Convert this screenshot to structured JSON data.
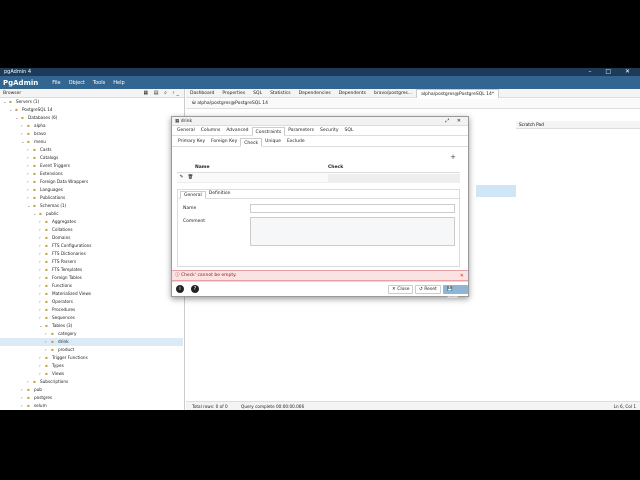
{
  "window": {
    "title": "pgAdmin 4",
    "controls": [
      "–",
      "□",
      "✕"
    ]
  },
  "menu": {
    "logo": "PgAdmin",
    "items": [
      "File",
      "Object",
      "Tools",
      "Help"
    ]
  },
  "browser": {
    "title": "Browser",
    "tree": [
      {
        "label": "Servers (1)",
        "indent": 0,
        "open": true
      },
      {
        "label": "PostgreSQL 14",
        "indent": 1,
        "open": true
      },
      {
        "label": "Databases (6)",
        "indent": 2,
        "open": true
      },
      {
        "label": "alpha",
        "indent": 3,
        "open": false
      },
      {
        "label": "bravo",
        "indent": 3,
        "open": false
      },
      {
        "label": "menu",
        "indent": 3,
        "open": true
      },
      {
        "label": "Casts",
        "indent": 4,
        "open": false
      },
      {
        "label": "Catalogs",
        "indent": 4,
        "open": false
      },
      {
        "label": "Event Triggers",
        "indent": 4,
        "open": false
      },
      {
        "label": "Extensions",
        "indent": 4,
        "open": false
      },
      {
        "label": "Foreign Data Wrappers",
        "indent": 4,
        "open": false
      },
      {
        "label": "Languages",
        "indent": 4,
        "open": false
      },
      {
        "label": "Publications",
        "indent": 4,
        "open": false
      },
      {
        "label": "Schemas (1)",
        "indent": 4,
        "open": true
      },
      {
        "label": "public",
        "indent": 5,
        "open": true
      },
      {
        "label": "Aggregates",
        "indent": 6,
        "open": false
      },
      {
        "label": "Collations",
        "indent": 6,
        "open": false
      },
      {
        "label": "Domains",
        "indent": 6,
        "open": false
      },
      {
        "label": "FTS Configurations",
        "indent": 6,
        "open": false
      },
      {
        "label": "FTS Dictionaries",
        "indent": 6,
        "open": false
      },
      {
        "label": "FTS Parsers",
        "indent": 6,
        "open": false
      },
      {
        "label": "FTS Templates",
        "indent": 6,
        "open": false
      },
      {
        "label": "Foreign Tables",
        "indent": 6,
        "open": false
      },
      {
        "label": "Functions",
        "indent": 6,
        "open": false
      },
      {
        "label": "Materialized Views",
        "indent": 6,
        "open": false
      },
      {
        "label": "Operators",
        "indent": 6,
        "open": false
      },
      {
        "label": "Procedures",
        "indent": 6,
        "open": false
      },
      {
        "label": "Sequences",
        "indent": 6,
        "open": false
      },
      {
        "label": "Tables (3)",
        "indent": 6,
        "open": true
      },
      {
        "label": "category",
        "indent": 7,
        "open": false
      },
      {
        "label": "drink",
        "indent": 7,
        "open": false,
        "selected": true
      },
      {
        "label": "product",
        "indent": 7,
        "open": false
      },
      {
        "label": "Trigger Functions",
        "indent": 6,
        "open": false
      },
      {
        "label": "Types",
        "indent": 6,
        "open": false
      },
      {
        "label": "Views",
        "indent": 6,
        "open": false
      },
      {
        "label": "Subscriptions",
        "indent": 4,
        "open": false
      },
      {
        "label": "pub",
        "indent": 3,
        "open": false
      },
      {
        "label": "postgres",
        "indent": 3,
        "open": false
      },
      {
        "label": "selum",
        "indent": 3,
        "open": false
      }
    ]
  },
  "main_tabs": [
    "Dashboard",
    "Properties",
    "SQL",
    "Statistics",
    "Dependencies",
    "Dependents",
    "bravo/postgres...",
    "alpha/postgres@PostgreSQL 14*"
  ],
  "query_tool": {
    "connection": "alpha/postgres@PostgreSQL 14"
  },
  "scratch_pad": "Scratch Pad",
  "status": {
    "rows": "Total rows: 0 of 0",
    "query": "Query complete 00:00:00.066",
    "position": "Ln 6, Col 1"
  },
  "dialog": {
    "title": "drink",
    "tabs": [
      "General",
      "Columns",
      "Advanced",
      "Constraints",
      "Parameters",
      "Security",
      "SQL"
    ],
    "active_tab": "Constraints",
    "subtabs": [
      "Primary Key",
      "Foreign Key",
      "Check",
      "Unique",
      "Exclude"
    ],
    "active_subtab": "Check",
    "grid_headers": [
      "Name",
      "Check"
    ],
    "edit_tabs": [
      "General",
      "Definition"
    ],
    "active_edit_tab": "General",
    "name_label": "Name",
    "comment_label": "Comment",
    "error": "Check' cannot be empty.",
    "buttons": {
      "close": "Close",
      "reset": "Reset",
      "save": "Save"
    }
  }
}
